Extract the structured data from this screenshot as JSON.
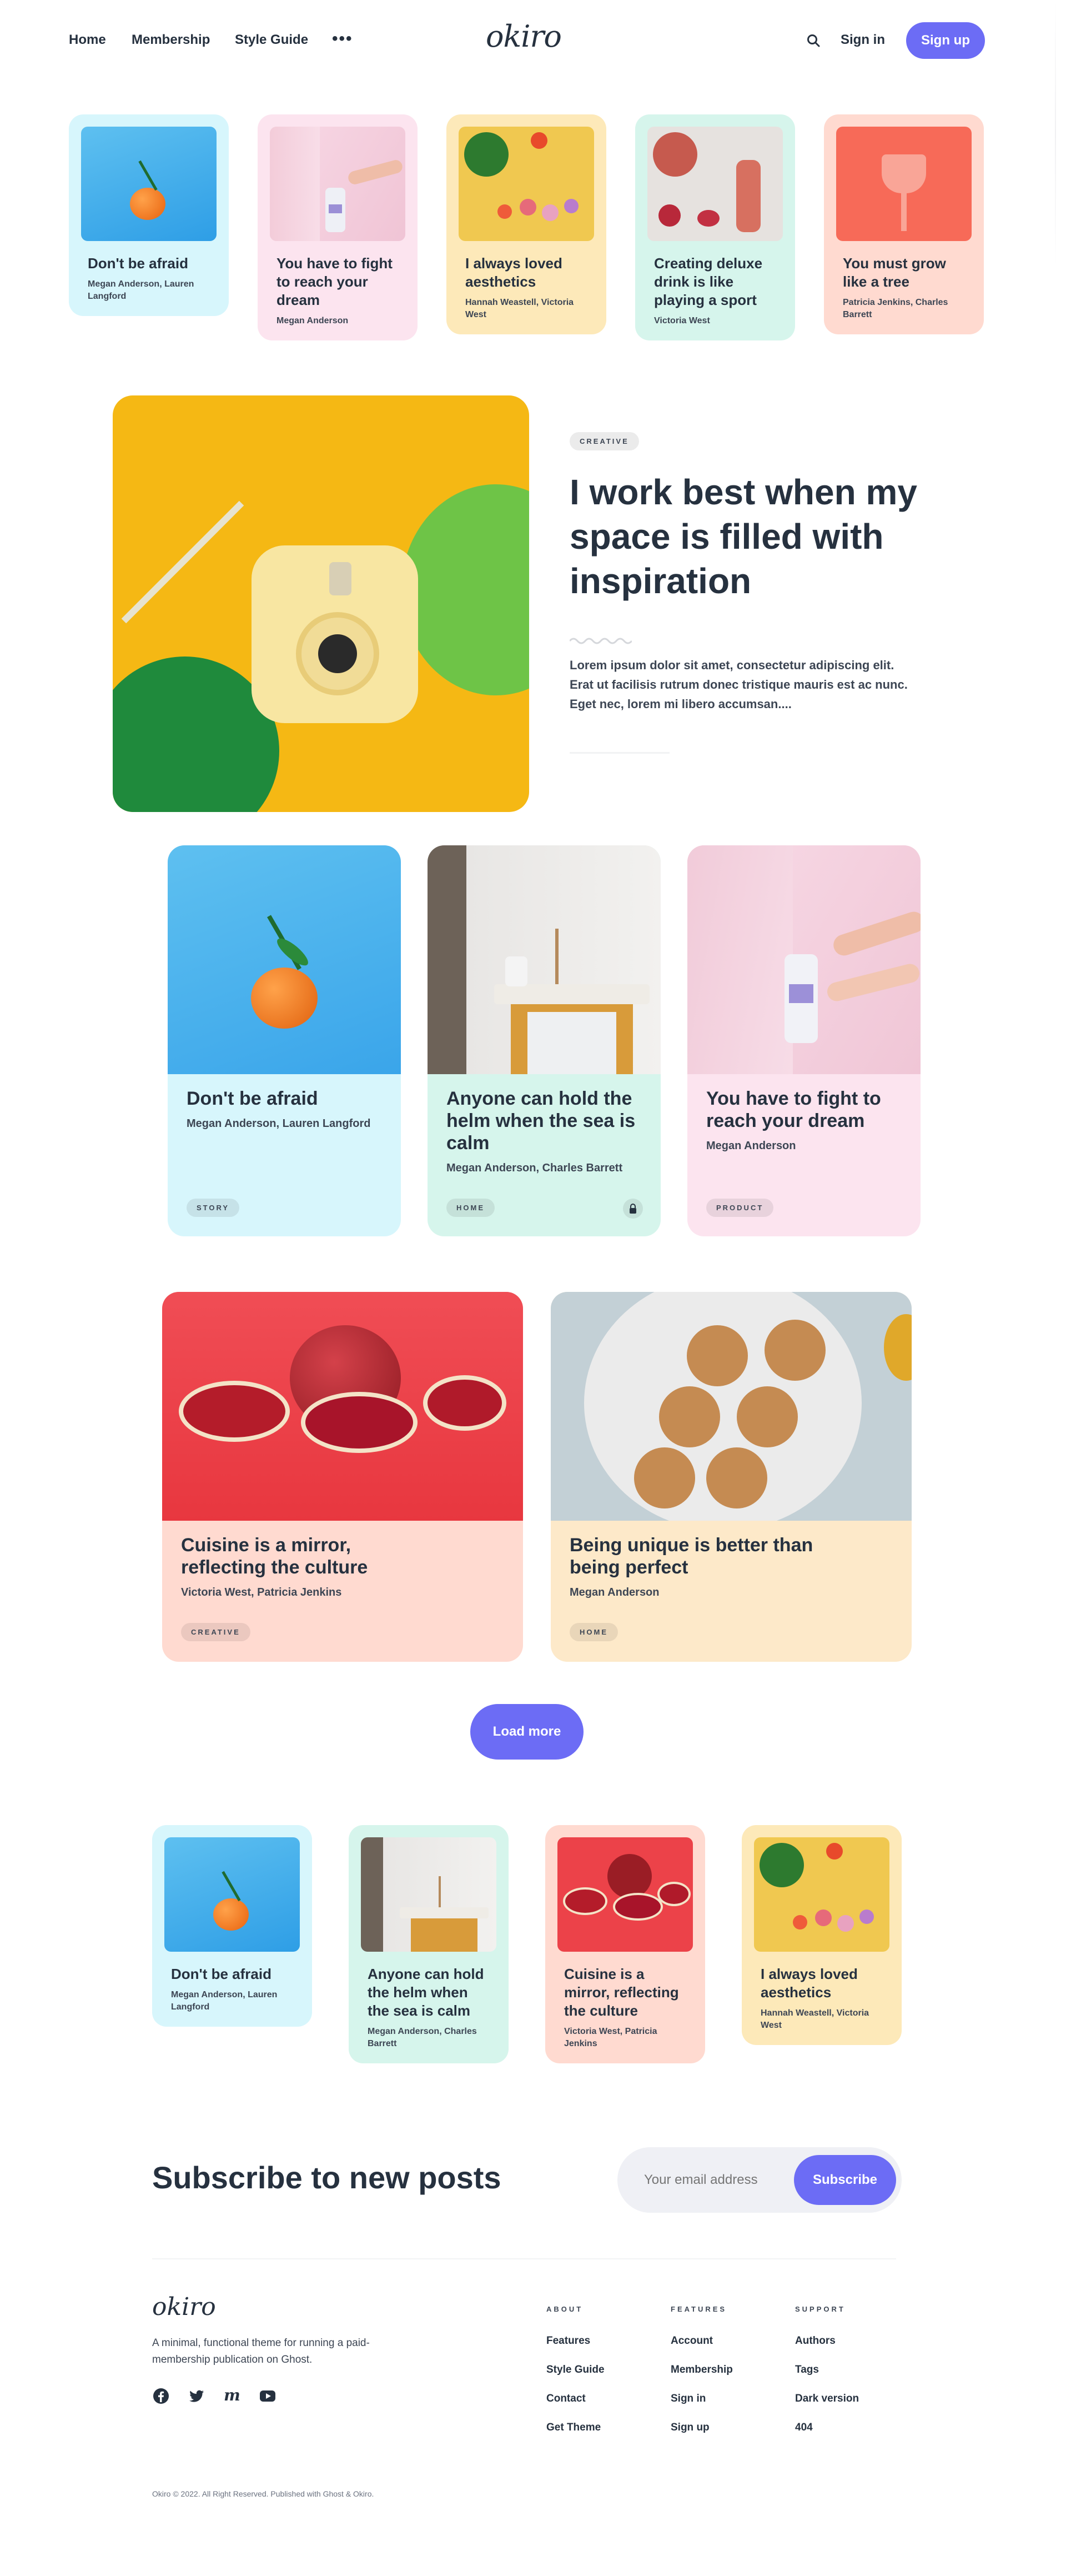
{
  "header": {
    "nav": [
      "Home",
      "Membership",
      "Style Guide"
    ],
    "more_icon": "dots-icon",
    "logo": "okiro",
    "search_icon": "search-icon",
    "sign_in": "Sign in",
    "sign_up": "Sign up"
  },
  "top_cards": [
    {
      "title": "Don't be afraid",
      "authors": "Megan Anderson, Lauren Langford",
      "bg": "#d7f6fc"
    },
    {
      "title": "You have to fight to reach your dream",
      "authors": "Megan Anderson",
      "bg": "#fce4ef"
    },
    {
      "title": "I always loved aesthetics",
      "authors": "Hannah Weastell, Victoria West",
      "bg": "#fde9b9"
    },
    {
      "title": "Creating deluxe drink is like playing a sport",
      "authors": "Victoria West",
      "bg": "#d6f5ec"
    },
    {
      "title": "You must grow like a tree",
      "authors": "Patricia Jenkins, Charles Barrett",
      "bg": "#ffdad0"
    }
  ],
  "featured": {
    "tag": "CREATIVE",
    "title": "I work best when my space is filled with inspiration",
    "excerpt": "Lorem ipsum dolor sit amet, consectetur adipiscing elit. Erat ut facilisis rutrum donec tristique mauris est ac nunc. Eget nec, lorem mi libero accumsan...."
  },
  "grid_cards": [
    {
      "title": "Don't be afraid",
      "authors": "Megan Anderson, Lauren Langford",
      "tag": "STORY",
      "bg": "#d7f6fc"
    },
    {
      "title": "Anyone can hold the helm when the sea is calm",
      "authors": "Megan Anderson, Charles Barrett",
      "tag": "HOME",
      "bg": "#d6f5ec",
      "locked_icon": "lock-icon"
    },
    {
      "title": "You have to fight to reach your dream",
      "authors": "Megan Anderson",
      "tag": "PRODUCT",
      "bg": "#fce4ef"
    }
  ],
  "wide_cards": [
    {
      "title": "Cuisine is a mirror, reflecting the culture",
      "authors": "Victoria West, Patricia Jenkins",
      "tag": "CREATIVE",
      "bg": "#ffdad0"
    },
    {
      "title": "Being unique is better than being perfect",
      "authors": "Megan Anderson",
      "tag": "HOME",
      "bg": "#fde9c9"
    }
  ],
  "load_more": "Load more",
  "bottom_cards": [
    {
      "title": "Don't be afraid",
      "authors": "Megan Anderson, Lauren Langford",
      "bg": "#d7f6fc"
    },
    {
      "title": "Anyone can hold the helm when the sea is calm",
      "authors": "Megan Anderson, Charles Barrett",
      "bg": "#d6f5ec"
    },
    {
      "title": "Cuisine is a mirror, reflecting the culture",
      "authors": "Victoria West, Patricia Jenkins",
      "bg": "#ffdad0"
    },
    {
      "title": "I always loved aesthetics",
      "authors": "Hannah Weastell, Victoria West",
      "bg": "#fde9b9"
    }
  ],
  "subscribe": {
    "heading": "Subscribe to new posts",
    "placeholder": "Your email address",
    "button": "Subscribe"
  },
  "footer": {
    "logo": "okiro",
    "description": "A minimal, functional theme for running a paid-membership publication on Ghost.",
    "social_icons": [
      "facebook-icon",
      "twitter-icon",
      "medium-icon",
      "youtube-icon"
    ],
    "columns": [
      {
        "heading": "ABOUT",
        "links": [
          "Features",
          "Style Guide",
          "Contact",
          "Get Theme"
        ]
      },
      {
        "heading": "FEATURES",
        "links": [
          "Account",
          "Membership",
          "Sign in",
          "Sign up"
        ]
      },
      {
        "heading": "SUPPORT",
        "links": [
          "Authors",
          "Tags",
          "Dark version",
          "404"
        ]
      }
    ],
    "copyright": "Okiro © 2022. All Right Reserved. Published with Ghost & Okiro."
  },
  "colors": {
    "accent": "#6c6cf5",
    "text": "#26313f"
  }
}
